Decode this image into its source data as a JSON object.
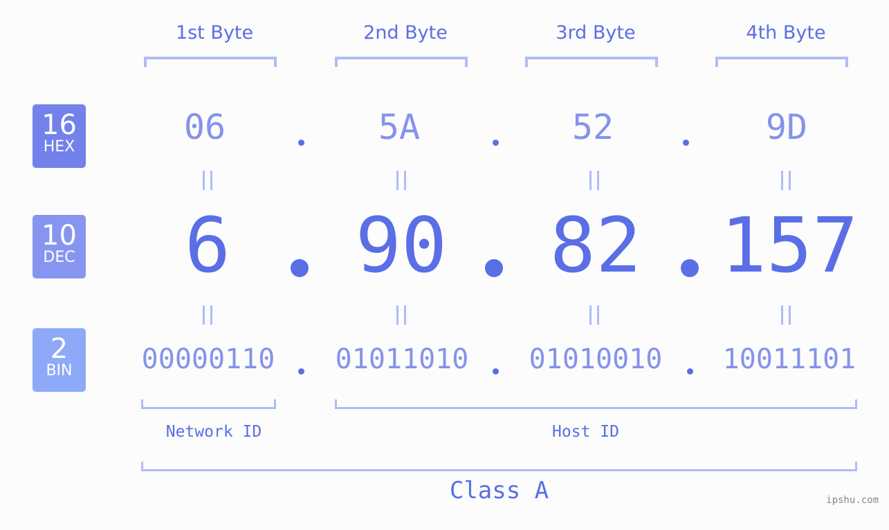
{
  "rows": {
    "hex": {
      "base": "16",
      "label": "HEX",
      "color": "#7381ea"
    },
    "dec": {
      "base": "10",
      "label": "DEC",
      "color": "#8795f0"
    },
    "bin": {
      "base": "2",
      "label": "BIN",
      "color": "#8ea9f8"
    }
  },
  "bytes": [
    {
      "label": "1st Byte",
      "hex": "06",
      "dec": "6",
      "bin": "00000110"
    },
    {
      "label": "2nd Byte",
      "hex": "5A",
      "dec": "90",
      "bin": "01011010"
    },
    {
      "label": "3rd Byte",
      "hex": "52",
      "dec": "82",
      "bin": "01010010"
    },
    {
      "label": "4th Byte",
      "hex": "9D",
      "dec": "157",
      "bin": "10011101"
    }
  ],
  "segments": {
    "network_id": "Network ID",
    "host_id": "Host ID",
    "class": "Class A"
  },
  "watermark": "ipshu.com",
  "colors": {
    "accent": "#5a6ee6",
    "light": "#8592ec",
    "bracket": "#b0bcf5",
    "background": "#fbfcfb"
  }
}
